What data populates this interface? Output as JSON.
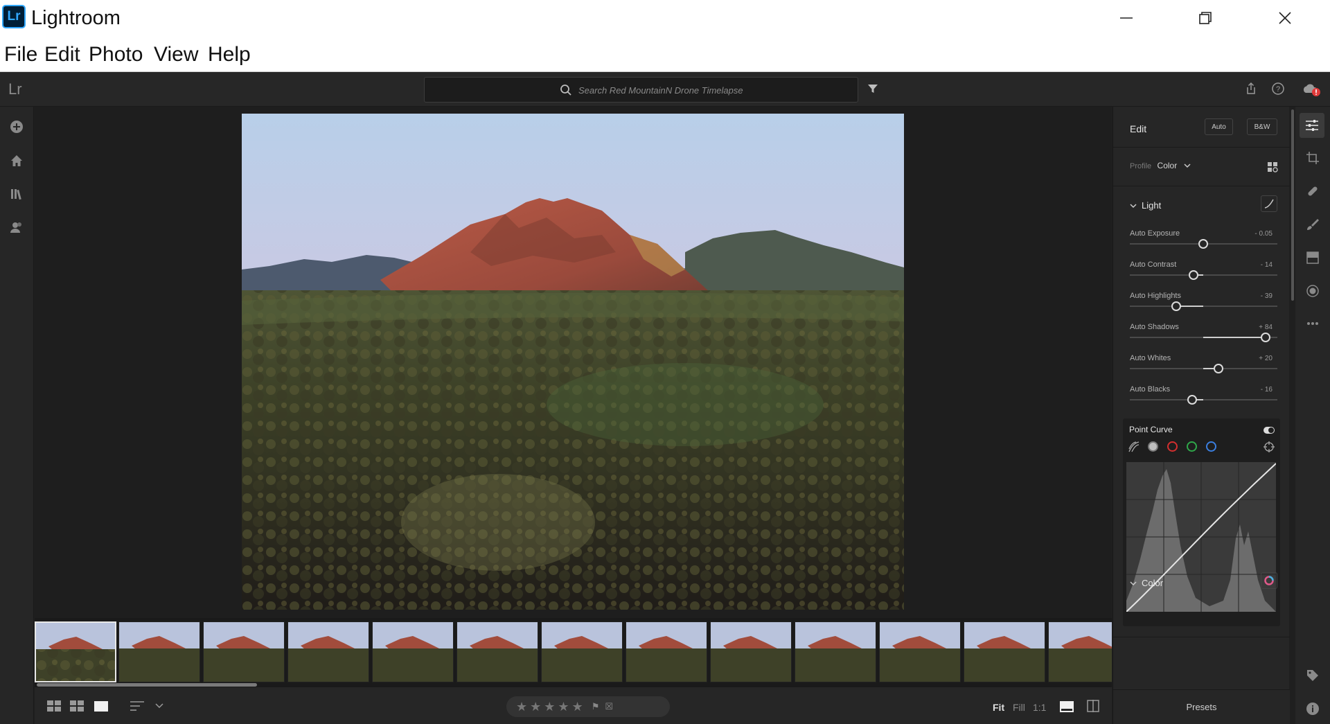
{
  "window": {
    "app_logo": "Lr",
    "title": "Lightroom"
  },
  "menu": [
    "File",
    "Edit",
    "Photo",
    "View",
    "Help"
  ],
  "toolbar": {
    "lr_mark": "Lr",
    "search_placeholder": "Search Red MountainN Drone Timelapse"
  },
  "bottombar": {
    "zoom_options": [
      "Fit",
      "Fill",
      "1:1"
    ],
    "zoom_active": "Fit",
    "stars": "★★★★★"
  },
  "edit_panel": {
    "title": "Edit",
    "auto_label": "Auto",
    "bw_label": "B&W",
    "profile_label": "Profile",
    "profile_value": "Color",
    "light_section": "Light",
    "sliders": [
      {
        "label": "Auto Exposure",
        "value": "- 0.05",
        "position": 0.5
      },
      {
        "label": "Auto Contrast",
        "value": "- 14",
        "position": 0.43
      },
      {
        "label": "Auto Highlights",
        "value": "- 39",
        "position": 0.31
      },
      {
        "label": "Auto Shadows",
        "value": "+ 84",
        "position": 0.92
      },
      {
        "label": "Auto Whites",
        "value": "+ 20",
        "position": 0.6
      },
      {
        "label": "Auto Blacks",
        "value": "- 16",
        "position": 0.42
      }
    ],
    "point_curve_title": "Point Curve",
    "color_section": "Color",
    "presets_label": "Presets"
  },
  "colors": {
    "accent_blue": "#31a8ff",
    "channel_red": "#d42f2f",
    "channel_green": "#2fa84a",
    "channel_blue": "#3b7fe0"
  }
}
